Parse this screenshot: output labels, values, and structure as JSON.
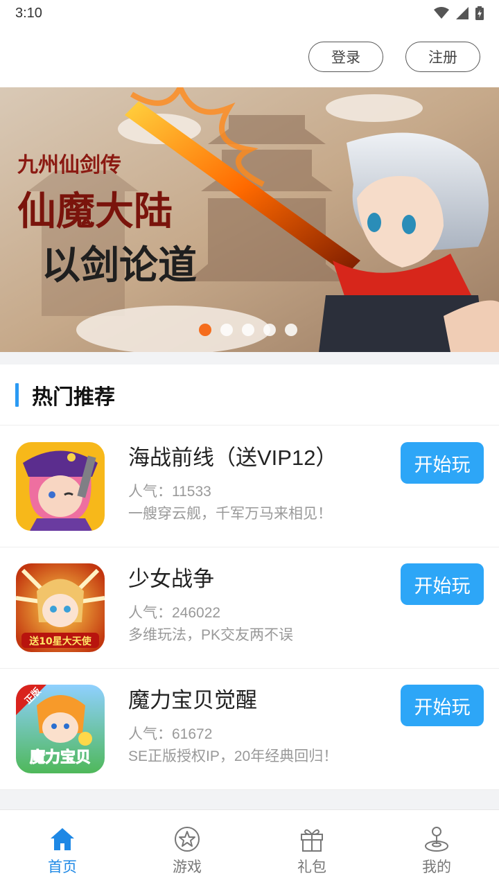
{
  "status_bar": {
    "time": "3:10"
  },
  "auth": {
    "login_label": "登录",
    "register_label": "注册"
  },
  "banner": {
    "logo_text": "九州仙剑传",
    "slogan_line1": "仙魔大陆",
    "slogan_line2": "以剑论道",
    "dots_count": 5,
    "active_dot": 0
  },
  "section": {
    "title": "热门推荐"
  },
  "games": [
    {
      "name": "海战前线（送VIP12）",
      "popularity": "人气：11533",
      "description": "一艘穿云舰，千军万马来相见！",
      "play_label": "开始玩"
    },
    {
      "name": "少女战争",
      "popularity": "人气：246022",
      "description": "多维玩法，PK交友两不误",
      "play_label": "开始玩",
      "icon_text": "送10星大天使"
    },
    {
      "name": "魔力宝贝觉醒",
      "popularity": "人气：61672",
      "description": "SE正版授权IP，20年经典回归！",
      "play_label": "开始玩",
      "icon_text": "魔力宝贝",
      "icon_badge": "正版"
    }
  ],
  "tabbar": {
    "tabs": [
      {
        "label": "首页",
        "icon": "home-icon",
        "active": true
      },
      {
        "label": "游戏",
        "icon": "star-icon",
        "active": false
      },
      {
        "label": "礼包",
        "icon": "gift-icon",
        "active": false
      },
      {
        "label": "我的",
        "icon": "joystick-icon",
        "active": false
      }
    ]
  },
  "colors": {
    "accent": "#2da6f7",
    "active_tab": "#1e88e5",
    "active_dot": "#f56c1c"
  }
}
